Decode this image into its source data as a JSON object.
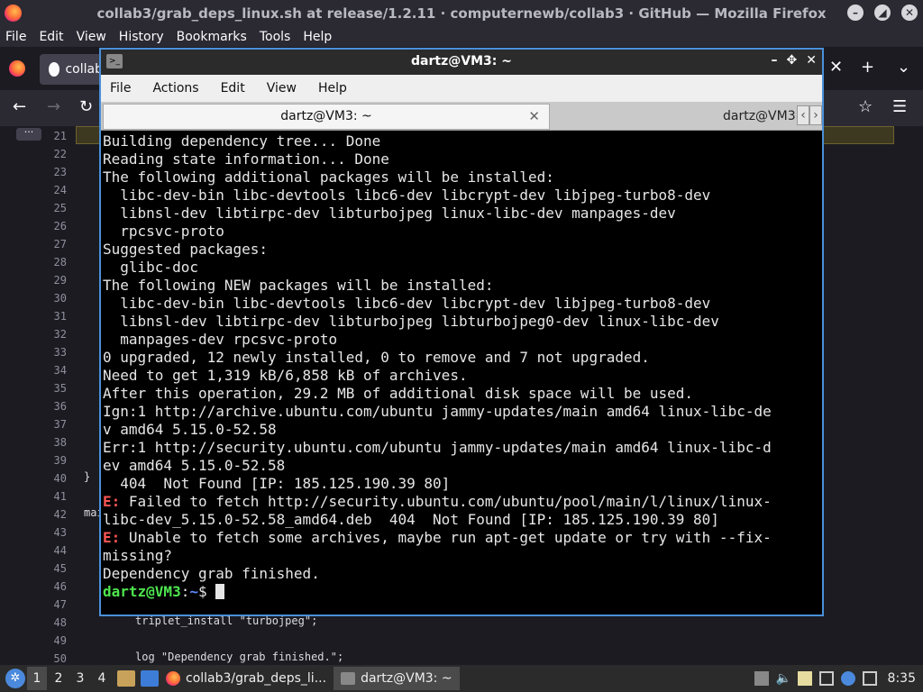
{
  "firefox": {
    "title": "collab3/grab_deps_linux.sh at release/1.2.11 · computernewb/collab3 · GitHub — Mozilla Firefox",
    "menu": [
      "File",
      "Edit",
      "View",
      "History",
      "Bookmarks",
      "Tools",
      "Help"
    ],
    "tab_label": "collab",
    "win_buttons": [
      "–",
      "◢",
      "✕"
    ],
    "tab_controls": [
      "✕",
      "+",
      "⌄"
    ],
    "nav_icons": [
      "back-icon",
      "forward-icon",
      "reload-icon",
      "star-icon",
      "menu-icon"
    ],
    "code": {
      "line_numbers": [
        "21",
        "22",
        "23",
        "24",
        "25",
        "26",
        "27",
        "28",
        "29",
        "30",
        "31",
        "32",
        "33",
        "34",
        "35",
        "36",
        "37",
        "38",
        "39",
        "40",
        "41",
        "42",
        "43",
        "44",
        "45",
        "46",
        "47",
        "48",
        "49",
        "50"
      ],
      "line_40_text": "}",
      "line_42_text": "mai",
      "line_48_text": "triplet_install \"turbojpeg\";",
      "line_50_text": "log \"Dependency grab finished.\";"
    }
  },
  "terminal": {
    "title": "dartz@VM3: ~",
    "menu": [
      "File",
      "Actions",
      "Edit",
      "View",
      "Help"
    ],
    "tab_active": "dartz@VM3: ~",
    "tab_inactive": "dartz@VM3",
    "tab_close": "✕",
    "title_buttons": [
      "–",
      "✥",
      "✕"
    ],
    "lines": [
      "Building dependency tree... Done",
      "Reading state information... Done",
      "The following additional packages will be installed:",
      "  libc-dev-bin libc-devtools libc6-dev libcrypt-dev libjpeg-turbo8-dev",
      "  libnsl-dev libtirpc-dev libturbojpeg linux-libc-dev manpages-dev",
      "  rpcsvc-proto",
      "Suggested packages:",
      "  glibc-doc",
      "The following NEW packages will be installed:",
      "  libc-dev-bin libc-devtools libc6-dev libcrypt-dev libjpeg-turbo8-dev",
      "  libnsl-dev libtirpc-dev libturbojpeg libturbojpeg0-dev linux-libc-dev",
      "  manpages-dev rpcsvc-proto",
      "0 upgraded, 12 newly installed, 0 to remove and 7 not upgraded.",
      "Need to get 1,319 kB/6,858 kB of archives.",
      "After this operation, 29.2 MB of additional disk space will be used.",
      "Ign:1 http://archive.ubuntu.com/ubuntu jammy-updates/main amd64 linux-libc-de",
      "v amd64 5.15.0-52.58",
      "Err:1 http://security.ubuntu.com/ubuntu jammy-updates/main amd64 linux-libc-d",
      "ev amd64 5.15.0-52.58",
      "  404  Not Found [IP: 185.125.190.39 80]"
    ],
    "err1_prefix": "E:",
    "err1_line1": " Failed to fetch http://security.ubuntu.com/ubuntu/pool/main/l/linux/linux-",
    "err1_line2": "libc-dev_5.15.0-52.58_amd64.deb  404  Not Found [IP: 185.125.190.39 80]",
    "err2_prefix": "E:",
    "err2_line1": " Unable to fetch some archives, maybe run apt-get update or try with --fix-",
    "err2_line2": "missing?",
    "final_line": "Dependency grab finished.",
    "prompt_user": "dartz@VM3",
    "prompt_sep": ":",
    "prompt_path": "~",
    "prompt_symbol": "$ "
  },
  "taskbar": {
    "workspaces": [
      "1",
      "2",
      "3",
      "4"
    ],
    "active_workspace": "1",
    "tasks": [
      {
        "label": "collab3/grab_deps_li...",
        "icon": "firefox-icon"
      },
      {
        "label": "dartz@VM3: ~",
        "icon": "terminal-icon"
      }
    ],
    "clock": "8:35"
  },
  "colors": {
    "terminal_border": "#4a90d9",
    "prompt_user": "#4ee44e",
    "prompt_path": "#5c8cff",
    "error": "#ff5555"
  }
}
